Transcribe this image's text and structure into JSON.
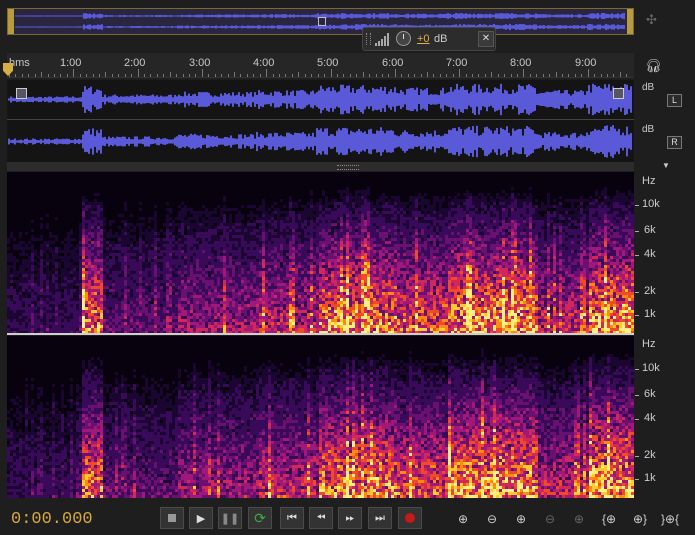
{
  "hud": {
    "volume_value": "+0",
    "volume_unit": "dB"
  },
  "ruler": {
    "labels": [
      "hms",
      "1:00",
      "2:00",
      "3:00",
      "4:00",
      "5:00",
      "6:00",
      "7:00",
      "8:00",
      "9:00"
    ]
  },
  "waveform": {
    "left": {
      "unit_label": "dB",
      "channel_button": "L"
    },
    "right": {
      "unit_label": "dB",
      "channel_button": "R"
    }
  },
  "spectral": {
    "top": {
      "unit_label": "Hz",
      "freq_labels": [
        "10k",
        "6k",
        "4k",
        "2k",
        "1k"
      ]
    },
    "bottom": {
      "unit_label": "Hz",
      "freq_labels": [
        "10k",
        "6k",
        "4k",
        "2k",
        "1k"
      ]
    }
  },
  "transport": {
    "time": "0:00.000",
    "buttons": [
      "stop-icon",
      "play-icon",
      "pause-icon",
      "loop-icon",
      "skip-to-start-icon",
      "rewind-icon",
      "fast-forward-icon",
      "skip-to-end-icon",
      "record-icon"
    ],
    "accent_color": "#d7a93e",
    "loop_color": "#3ea83e",
    "record_color": "#c41a1a"
  },
  "zoom": {
    "buttons": [
      "zoom-in-amplitude-icon",
      "zoom-out-amplitude-icon",
      "zoom-in-time-icon",
      "zoom-out-full-icon",
      "zoom-selection-icon",
      "zoom-in-left-icon",
      "zoom-in-right-icon",
      "zoom-out-time-icon"
    ]
  },
  "colors": {
    "waveform": "#5a5ad8",
    "background": "#1e1e1e",
    "ruler_marker": "#d6b040"
  }
}
